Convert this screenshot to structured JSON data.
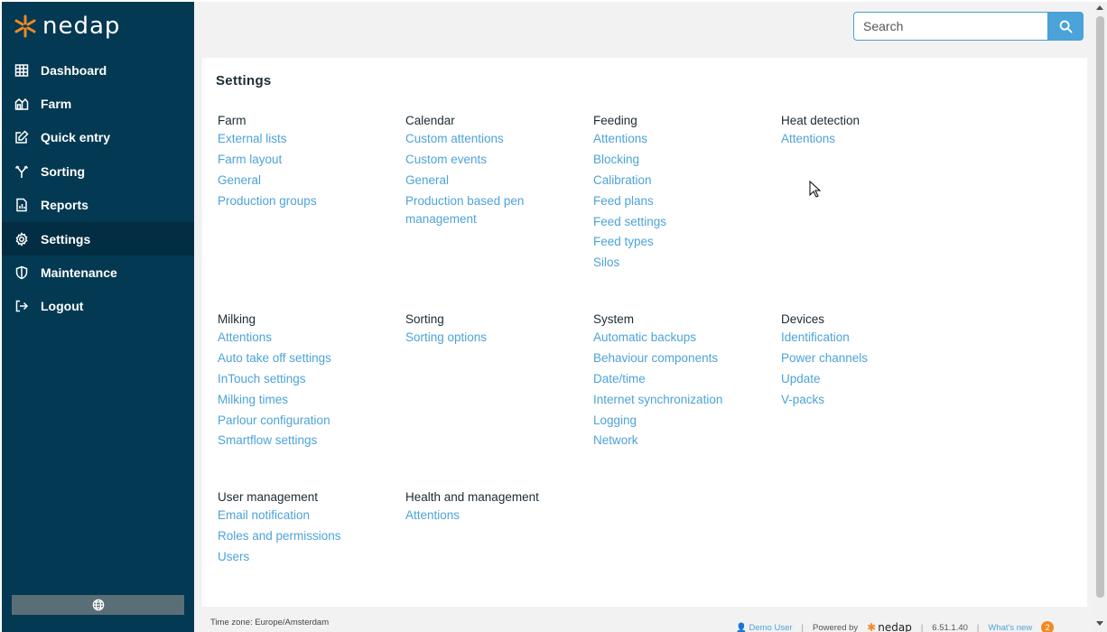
{
  "brand": {
    "name": "nedap",
    "accent": "#f08a24",
    "sidebar_bg": "#033952",
    "link_color": "#4da3d8"
  },
  "sidebar": {
    "items": [
      {
        "label": "Dashboard",
        "icon": "grid-icon",
        "active": false
      },
      {
        "label": "Farm",
        "icon": "farm-icon",
        "active": false
      },
      {
        "label": "Quick entry",
        "icon": "edit-icon",
        "active": false
      },
      {
        "label": "Sorting",
        "icon": "fork-icon",
        "active": false
      },
      {
        "label": "Reports",
        "icon": "report-icon",
        "active": false
      },
      {
        "label": "Settings",
        "icon": "gear-icon",
        "active": true
      },
      {
        "label": "Maintenance",
        "icon": "shield-icon",
        "active": false
      },
      {
        "label": "Logout",
        "icon": "logout-icon",
        "active": false
      }
    ],
    "language_icon": "globe-icon"
  },
  "search": {
    "placeholder": "Search",
    "value": ""
  },
  "page": {
    "title": "Settings"
  },
  "sections": [
    {
      "title": "Farm",
      "links": [
        "External lists",
        "Farm layout",
        "General",
        "Production groups"
      ]
    },
    {
      "title": "Calendar",
      "links": [
        "Custom attentions",
        "Custom events",
        "General",
        "Production based pen management"
      ]
    },
    {
      "title": "Feeding",
      "links": [
        "Attentions",
        "Blocking",
        "Calibration",
        "Feed plans",
        "Feed settings",
        "Feed types",
        "Silos"
      ]
    },
    {
      "title": "Heat detection",
      "links": [
        "Attentions"
      ]
    },
    {
      "title": "Milking",
      "links": [
        "Attentions",
        "Auto take off settings",
        "InTouch settings",
        "Milking times",
        "Parlour configuration",
        "Smartflow settings"
      ]
    },
    {
      "title": "Sorting",
      "links": [
        "Sorting options"
      ]
    },
    {
      "title": "System",
      "links": [
        "Automatic backups",
        "Behaviour components",
        "Date/time",
        "Internet synchronization",
        "Logging",
        "Network"
      ]
    },
    {
      "title": "Devices",
      "links": [
        "Identification",
        "Power channels",
        "Update",
        "V-packs"
      ]
    },
    {
      "title": "User management",
      "links": [
        "Email notification",
        "Roles and permissions",
        "Users"
      ]
    },
    {
      "title": "Health and management",
      "links": [
        "Attentions"
      ]
    }
  ],
  "footer": {
    "timezone": "Time zone: Europe/Amsterdam",
    "user": "Demo User",
    "powered_by": "Powered by",
    "powered_brand": "nedap",
    "version": "6.51.1.40",
    "whats_new": "What's new",
    "whats_new_count": "2"
  }
}
